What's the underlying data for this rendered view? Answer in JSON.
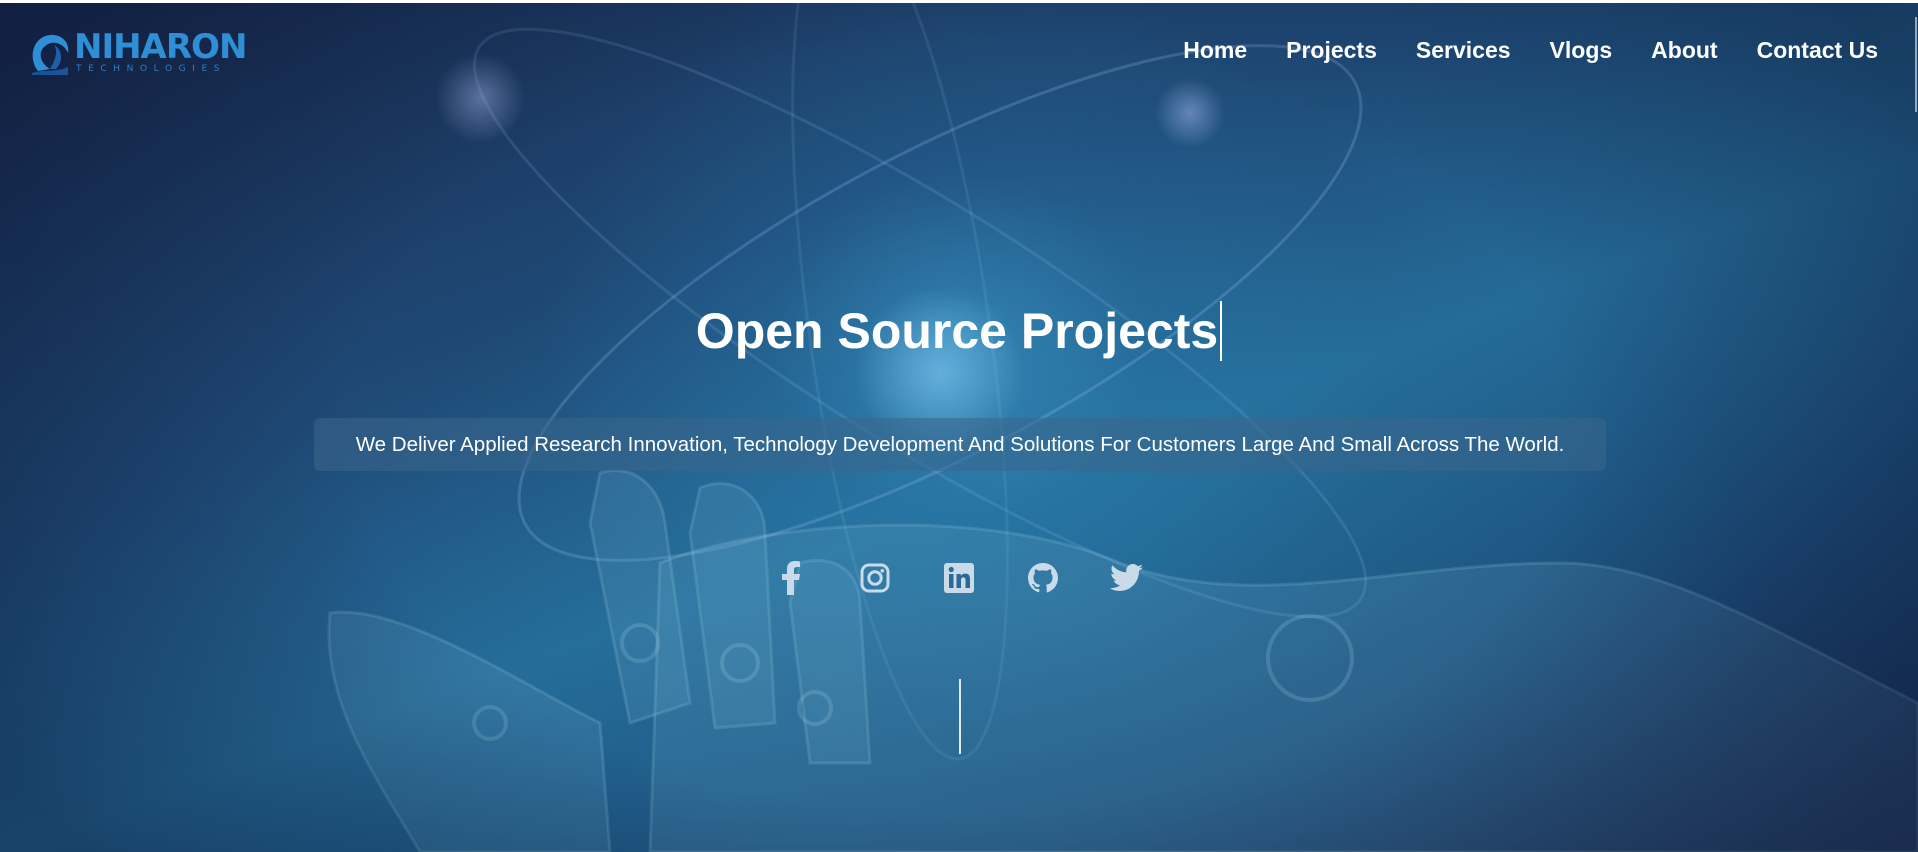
{
  "brand": {
    "name": "NIHARON",
    "subtitle": "TECHNOLOGIES"
  },
  "nav": {
    "items": [
      {
        "label": "Home"
      },
      {
        "label": "Projects"
      },
      {
        "label": "Services"
      },
      {
        "label": "Vlogs"
      },
      {
        "label": "About"
      },
      {
        "label": "Contact Us"
      }
    ]
  },
  "hero": {
    "title": "Open Source Projects",
    "tagline": "We Deliver Applied Research Innovation, Technology Development And Solutions For Customers Large And Small Across The World."
  },
  "socials": [
    {
      "icon": "facebook-icon"
    },
    {
      "icon": "instagram-icon"
    },
    {
      "icon": "linkedin-icon"
    },
    {
      "icon": "github-icon"
    },
    {
      "icon": "twitter-icon"
    }
  ],
  "colors": {
    "brand_blue": "#2f8fd6",
    "hero_bg": "#256b98",
    "text": "#ffffff"
  }
}
